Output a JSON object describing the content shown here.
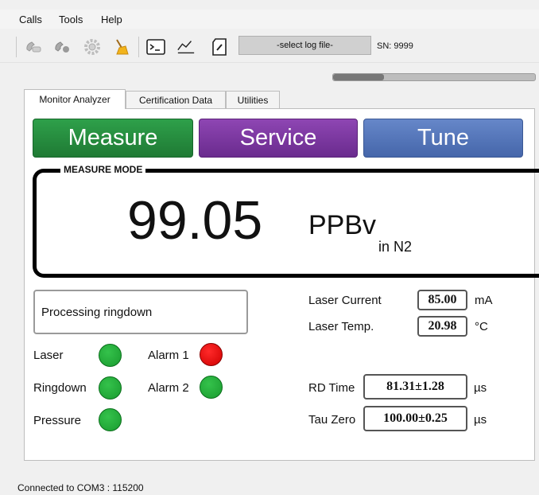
{
  "menu": {
    "items": [
      "Calls",
      "Tools",
      "Help"
    ]
  },
  "toolbar": {
    "log_file_button": "-select log file-",
    "serial_number": "SN: 9999"
  },
  "progress": {
    "fraction": 0.25
  },
  "tabs": [
    "Monitor Analyzer",
    "Certification Data",
    "Utilities"
  ],
  "mode_buttons": {
    "measure": {
      "label": "Measure",
      "color": "#279041"
    },
    "service": {
      "label": "Service",
      "color": "#7b3aa0"
    },
    "tune": {
      "label": "Tune",
      "color": "#5577bb"
    }
  },
  "measure_mode": {
    "title": "MEASURE MODE",
    "reading": "99.05",
    "unit": "PPBv",
    "unit_sub": "in N2"
  },
  "status_message": "Processing ringdown",
  "indicators": [
    {
      "label": "Laser",
      "state": "ok",
      "color": "#28a83c"
    },
    {
      "label": "Ringdown",
      "state": "ok",
      "color": "#28a83c"
    },
    {
      "label": "Pressure",
      "state": "ok",
      "color": "#28a83c"
    },
    {
      "label": "Alarm 1",
      "state": "alarm",
      "color": "#ee1111"
    },
    {
      "label": "Alarm 2",
      "state": "ok",
      "color": "#28a83c"
    }
  ],
  "readings": {
    "laser_current": {
      "label": "Laser Current",
      "value": "85.00",
      "unit": "mA"
    },
    "laser_temp": {
      "label": "Laser Temp.",
      "value": "20.98",
      "unit": "°C"
    },
    "rd_time": {
      "label": "RD Time",
      "value": "81.31±1.28",
      "unit": "µs"
    },
    "tau_zero": {
      "label": "Tau Zero",
      "value": "100.00±0.25",
      "unit": "µs"
    }
  },
  "statusbar": {
    "connection": "Connected to COM3 : 115200"
  },
  "icons": [
    "phone-icon",
    "phone-settings-icon",
    "gear-icon",
    "broom-icon",
    "terminal-icon",
    "chart-line-icon",
    "edit-document-icon"
  ]
}
